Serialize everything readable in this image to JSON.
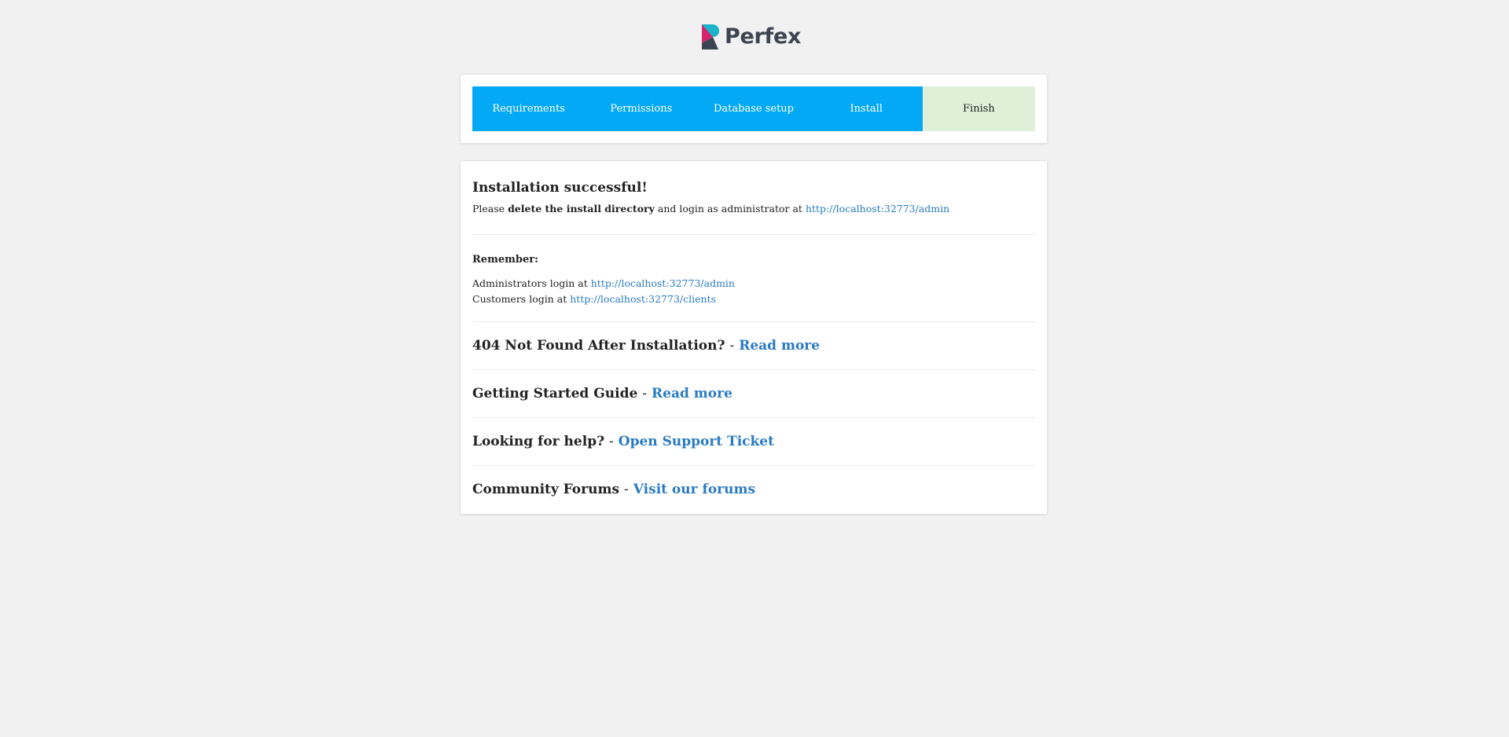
{
  "logo": {
    "text": "Perfex"
  },
  "steps": [
    {
      "label": "Requirements"
    },
    {
      "label": "Permissions"
    },
    {
      "label": "Database setup"
    },
    {
      "label": "Install"
    },
    {
      "label": "Finish"
    }
  ],
  "success": {
    "title": "Installation successful!",
    "please": "Please",
    "delete_bold": "delete the install directory",
    "and_login": "and login as administrator at",
    "admin_url": "http://localhost:32773/admin"
  },
  "remember": {
    "title": "Remember:",
    "admin_label": "Administrators login at",
    "admin_url": "http://localhost:32773/admin",
    "clients_label": "Customers login at",
    "clients_url": "http://localhost:32773/clients"
  },
  "links": [
    {
      "title": "404 Not Found After Installation?",
      "sep": "-",
      "link": "Read more"
    },
    {
      "title": "Getting Started Guide",
      "sep": "-",
      "link": "Read more"
    },
    {
      "title": "Looking for help?",
      "sep": "-",
      "link": "Open Support Ticket"
    },
    {
      "title": "Community Forums",
      "sep": "-",
      "link": "Visit our forums"
    }
  ],
  "colors": {
    "step_active": "#03a9f4",
    "step_finish": "#dff0d8",
    "link": "#2a7ac2"
  }
}
